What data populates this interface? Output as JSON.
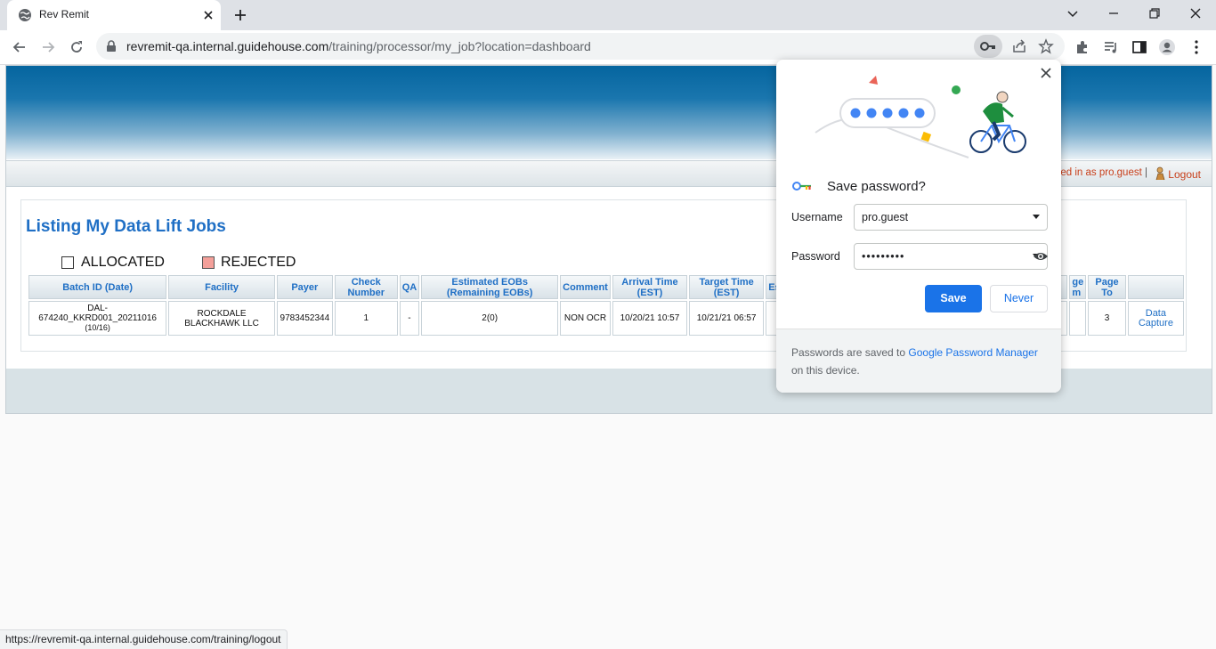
{
  "browser": {
    "tab_title": "Rev Remit",
    "url_host": "revremit-qa.internal.guidehouse.com",
    "url_path": "/training/processor/my_job?location=dashboard",
    "status_url": "https://revremit-qa.internal.guidehouse.com/training/logout"
  },
  "header": {
    "logged_in_text": "ged in as pro.guest",
    "separator": "|",
    "logout_label": "Logout"
  },
  "main": {
    "title": "Listing My Data Lift Jobs",
    "legend": [
      {
        "label": "ALLOCATED",
        "color": "#ffffff"
      },
      {
        "label": "REJECTED",
        "color": "#f4a09a"
      }
    ],
    "columns": [
      "Batch ID (Date)",
      "Facility",
      "Payer",
      "Check Number",
      "QA",
      "Estimated EOBs (Remaining EOBs)",
      "Comment",
      "Arrival Time (EST)",
      "Target Time (EST)",
      "Es",
      "ge m",
      "Page To",
      ""
    ],
    "rows": [
      {
        "batch_id": "DAL-674240_KKRD001_20211016",
        "batch_date": "(10/16)",
        "facility": "ROCKDALE BLACKHAWK LLC",
        "payer": "9783452344",
        "check_number": "1",
        "qa": "-",
        "estimated_eobs": "2(0)",
        "comment": "NON OCR",
        "arrival_time": "10/20/21 10:57",
        "target_time": "10/21/21 06:57",
        "page_to": "3",
        "action": "Data Capture"
      }
    ]
  },
  "popup": {
    "title": "Save password?",
    "username_label": "Username",
    "username_value": "pro.guest",
    "password_label": "Password",
    "password_value": "•••••••••",
    "save_label": "Save",
    "never_label": "Never",
    "footer_text_before": "Passwords are saved to ",
    "footer_link": "Google Password Manager",
    "footer_text_after": " on this device."
  },
  "colors": {
    "accent": "#1a73e8",
    "title_blue": "#1f6fc5",
    "logout_orange": "#c8401c"
  }
}
